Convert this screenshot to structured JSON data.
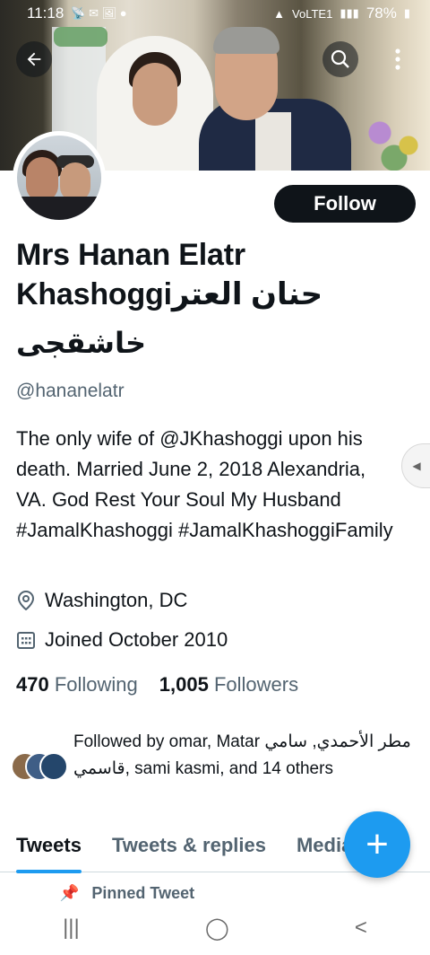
{
  "status_bar": {
    "time": "11:18",
    "battery": "78%",
    "network": "VoLTE1"
  },
  "profile": {
    "follow_label": "Follow",
    "name_line1": "Mrs Hanan Elatr",
    "name_line2": "Khashoggiحنان العتر",
    "name_line3": "خاشقجى",
    "handle": "@hananelatr",
    "bio": "The only wife of @JKhashoggi upon his death. Married June 2, 2018 Alexandria, VA. God Rest Your Soul My Husband #JamalKhashoggi #JamalKhashoggiFamily",
    "location": "Washington, DC",
    "joined": "Joined October 2010",
    "following_count": "470",
    "following_label": "Following",
    "followers_count": "1,005",
    "followers_label": "Followers",
    "followed_by": "Followed by omar, Matar مطر الأحمدي, سامي قاسمي, sami kasmi, and 14 others"
  },
  "tabs": [
    {
      "label": "Tweets"
    },
    {
      "label": "Tweets & replies"
    },
    {
      "label": "Media"
    }
  ],
  "pinned_label": "Pinned Tweet",
  "fab_label": "+",
  "nav": {
    "recent": "|||",
    "home": "◯",
    "back": "<"
  },
  "colors": {
    "accent": "#1d9bf0",
    "text": "#0f1419",
    "secondary": "#536471"
  }
}
